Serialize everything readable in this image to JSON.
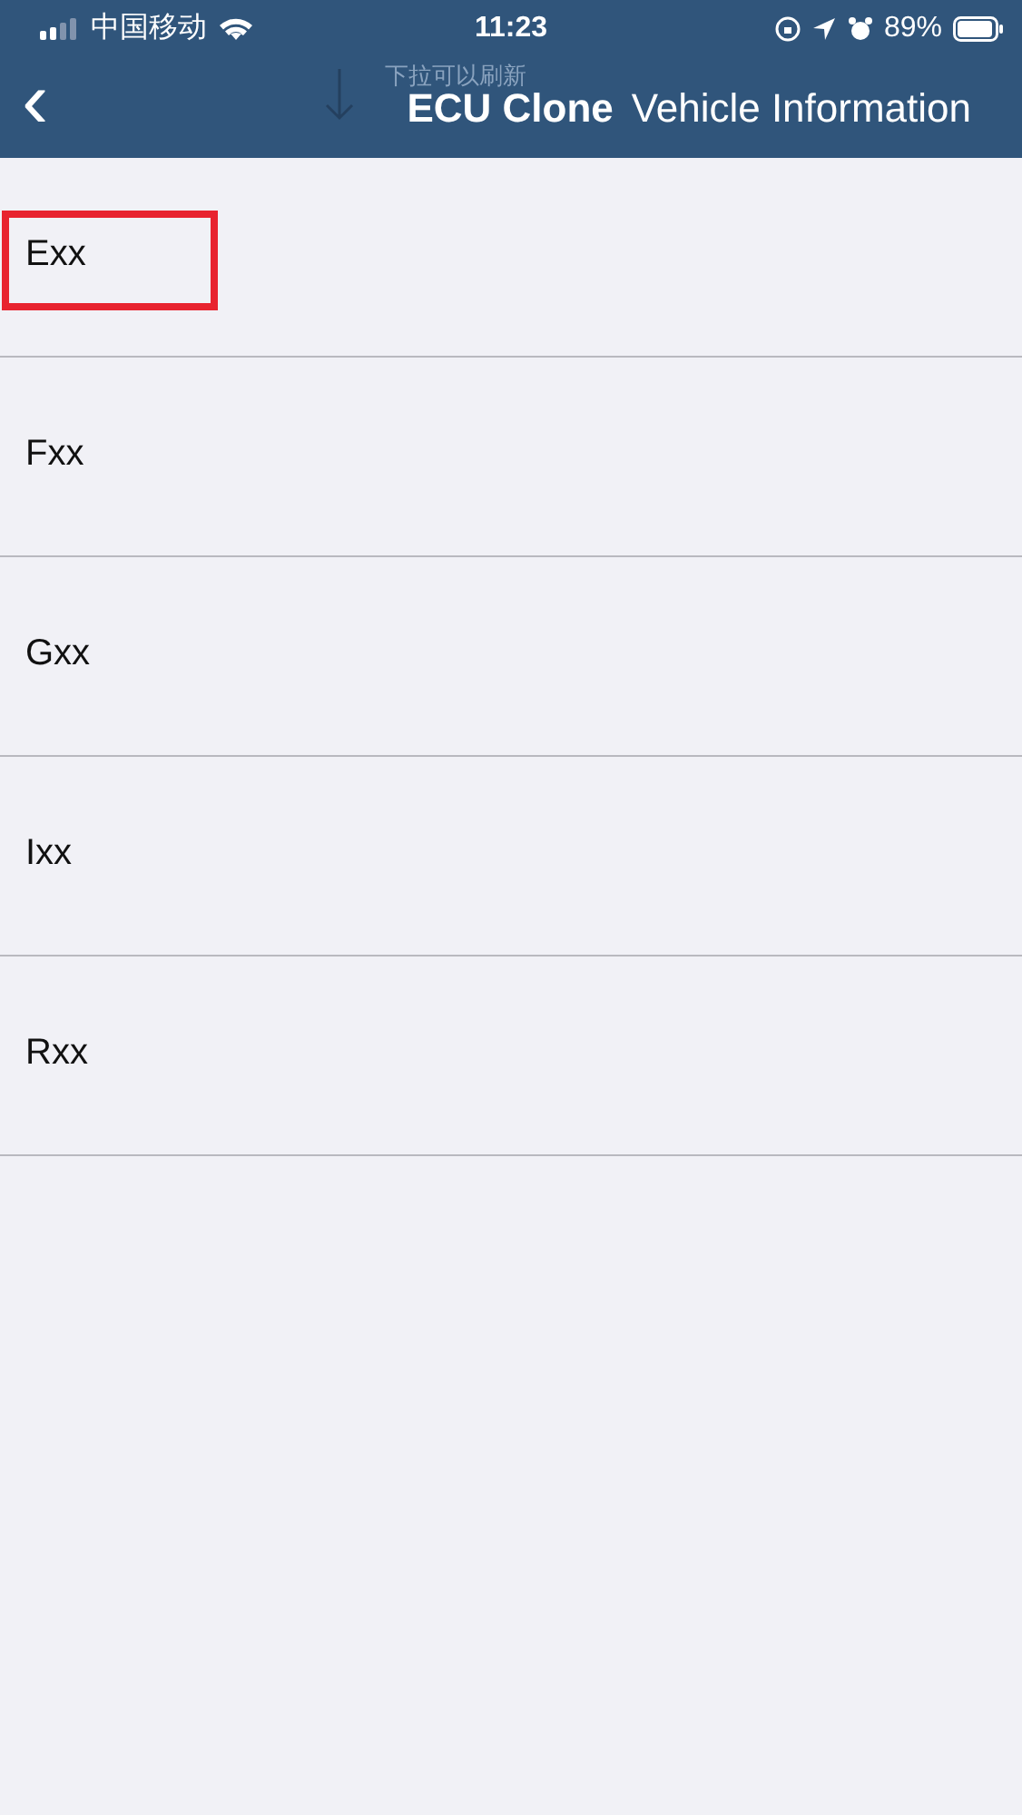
{
  "status_bar": {
    "carrier": "中国移动",
    "time": "11:23",
    "battery": "89%"
  },
  "nav_bar": {
    "back": "‹",
    "hint": "下拉可以刷新",
    "title_bold": "ECU Clone",
    "title": "Vehicle Information"
  },
  "items": [
    {
      "label": "Exx",
      "highlighted": true
    },
    {
      "label": "Fxx",
      "highlighted": false
    },
    {
      "label": "Gxx",
      "highlighted": false
    },
    {
      "label": "Ixx",
      "highlighted": false
    },
    {
      "label": "Rxx",
      "highlighted": false
    }
  ]
}
